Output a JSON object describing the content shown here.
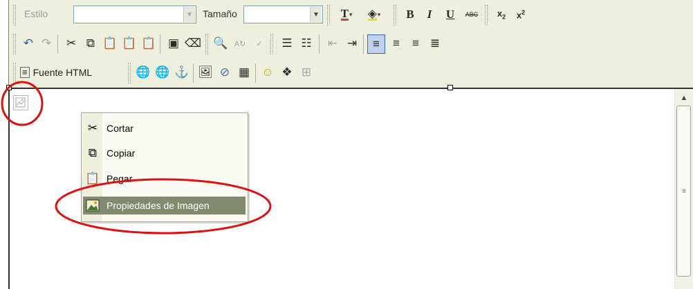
{
  "toolbar": {
    "style_label": "Estilo",
    "style_value": "",
    "size_label": "Tamaño",
    "size_value": "",
    "html_source_label": "Fuente HTML"
  },
  "context_menu": {
    "items": [
      {
        "label": "Cortar",
        "icon": "scissors-icon"
      },
      {
        "label": "Copiar",
        "icon": "copy-icon"
      },
      {
        "label": "Pegar",
        "icon": "paste-icon"
      },
      {
        "label": "Propiedades de Imagen",
        "icon": "image-icon",
        "highlighted": true
      }
    ]
  },
  "annotation": {
    "color": "#e01010"
  }
}
